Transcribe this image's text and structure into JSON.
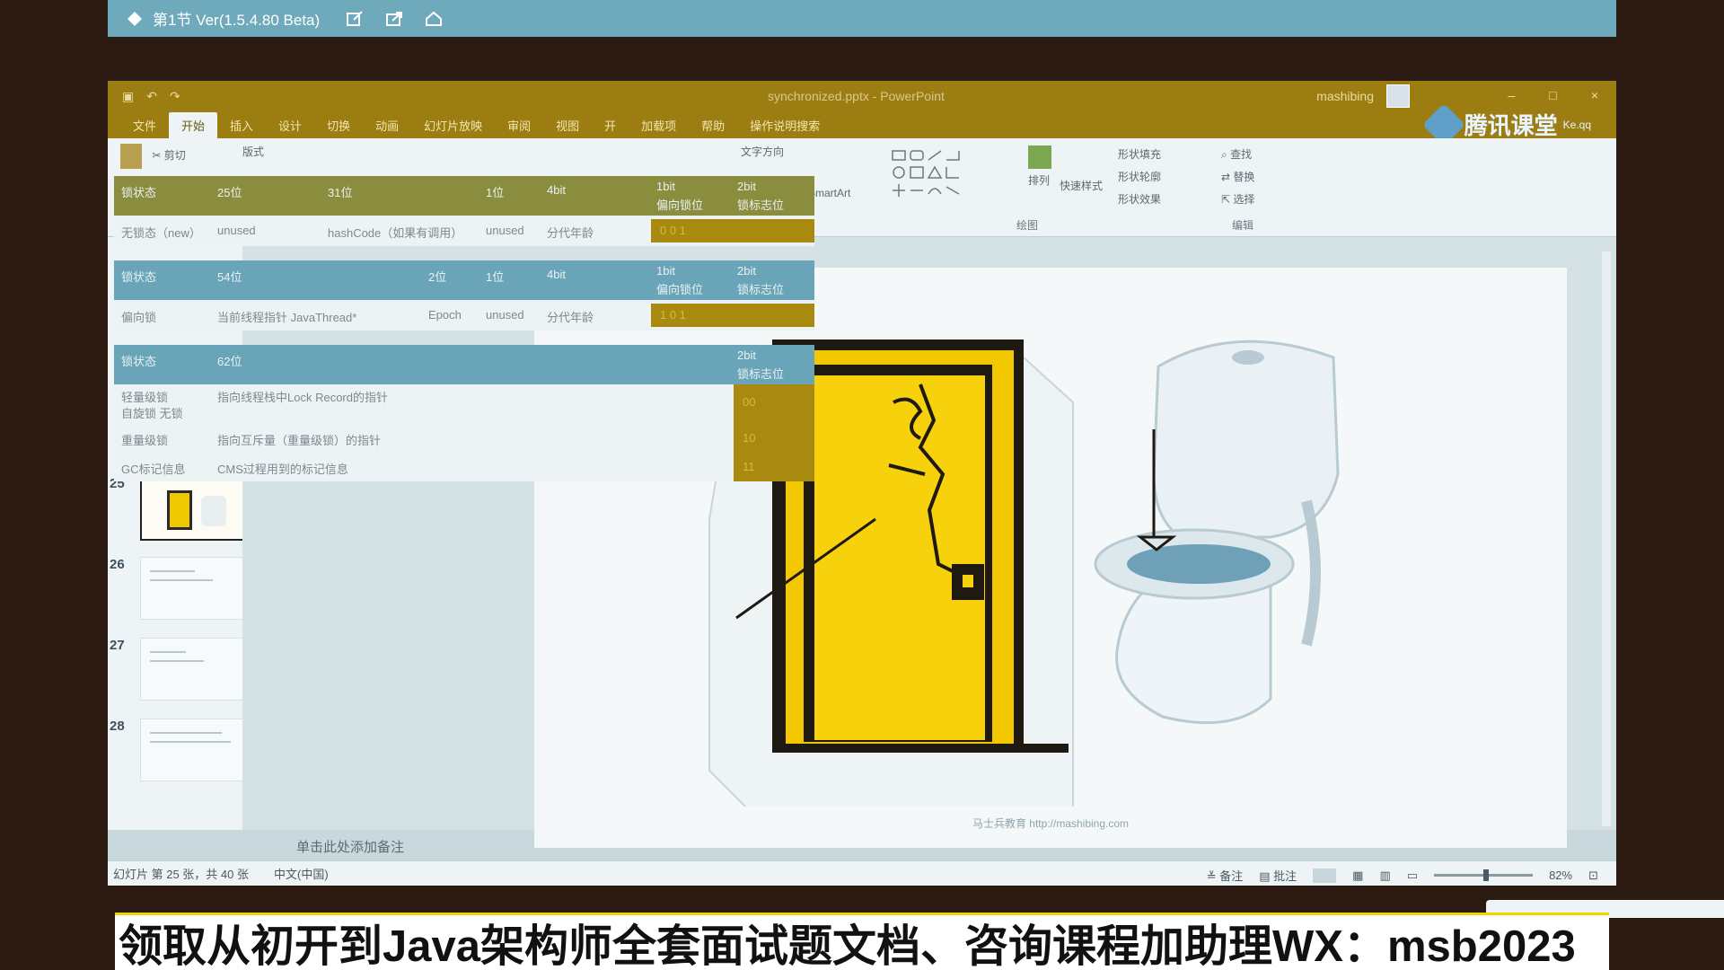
{
  "player": {
    "title": "第1节 Ver(1.5.4.80 Beta)"
  },
  "window": {
    "doc_title": "synchronized.pptx - PowerPoint",
    "user": "mashibing",
    "brand": "腾讯课堂",
    "brand_sub": "Ke.qq"
  },
  "ribbon": {
    "tabs": [
      "文件",
      "开始",
      "插入",
      "设计",
      "切换",
      "动画",
      "幻灯片放映",
      "审阅",
      "视图",
      "开",
      "加载项",
      "帮助",
      "操作说明搜索"
    ],
    "active_tab": "开始",
    "cut": "剪切",
    "layout": "版式",
    "text_direction": "文字方向",
    "smartart": "SmartArt",
    "arrange": "排列",
    "quick_styles": "快速样式",
    "shape_fill": "形状填充",
    "shape_outline": "形状轮廓",
    "shape_effects": "形状效果",
    "find": "查找",
    "replace": "替换",
    "select": "选择",
    "group_drawing": "绘图",
    "group_editing": "编辑"
  },
  "slides": {
    "numbers": [
      "25",
      "26",
      "27",
      "28"
    ],
    "selected": "25"
  },
  "slide": {
    "footer": "马士兵教育 http://mashibing.com"
  },
  "notes_placeholder": "单击此处添加备注",
  "status": {
    "slide_info": "幻灯片 第 25 张，共 40 张",
    "language": "中文(中国)",
    "notes": "备注",
    "comments": "批注",
    "zoom": "82%"
  },
  "table": {
    "row1": {
      "c1": "锁状态",
      "c2": "25位",
      "c3": "31位",
      "c4": "1位",
      "c5": "4bit",
      "c6a": "1bit",
      "c6b": "偏向锁位",
      "c7a": "2bit",
      "c7b": "锁标志位"
    },
    "row2": {
      "c1": "无锁态（new）",
      "c2": "unused",
      "c3": "hashCode（如果有调用）",
      "c4": "unused",
      "c5": "分代年龄",
      "bits": "0 0 1"
    },
    "row3": {
      "c1": "锁状态",
      "c2": "54位",
      "c3": "2位",
      "c4": "1位",
      "c5": "4bit",
      "c6a": "1bit",
      "c6b": "偏向锁位",
      "c7a": "2bit",
      "c7b": "锁标志位"
    },
    "row4": {
      "c1": "偏向锁",
      "c2": "当前线程指针 JavaThread*",
      "c3": "Epoch",
      "c4": "unused",
      "c5": "分代年龄",
      "bits": "1 0 1"
    },
    "row5": {
      "c1": "锁状态",
      "c2": "62位",
      "c7a": "2bit",
      "c7b": "锁标志位"
    },
    "row6": {
      "c1a": "轻量级锁",
      "c1b": "自旋锁 无锁",
      "c2": "指向线程栈中Lock Record的指针",
      "bits": "00"
    },
    "row7": {
      "c1": "重量级锁",
      "c2": "指向互斥量（重量级锁）的指针",
      "bits": "10"
    },
    "row8": {
      "c1": "GC标记信息",
      "c2": "CMS过程用到的标记信息",
      "bits": "11"
    }
  },
  "caption": "领取从初开到Java架构师全套面试题文档、咨询课程加助理WX：msb2023"
}
